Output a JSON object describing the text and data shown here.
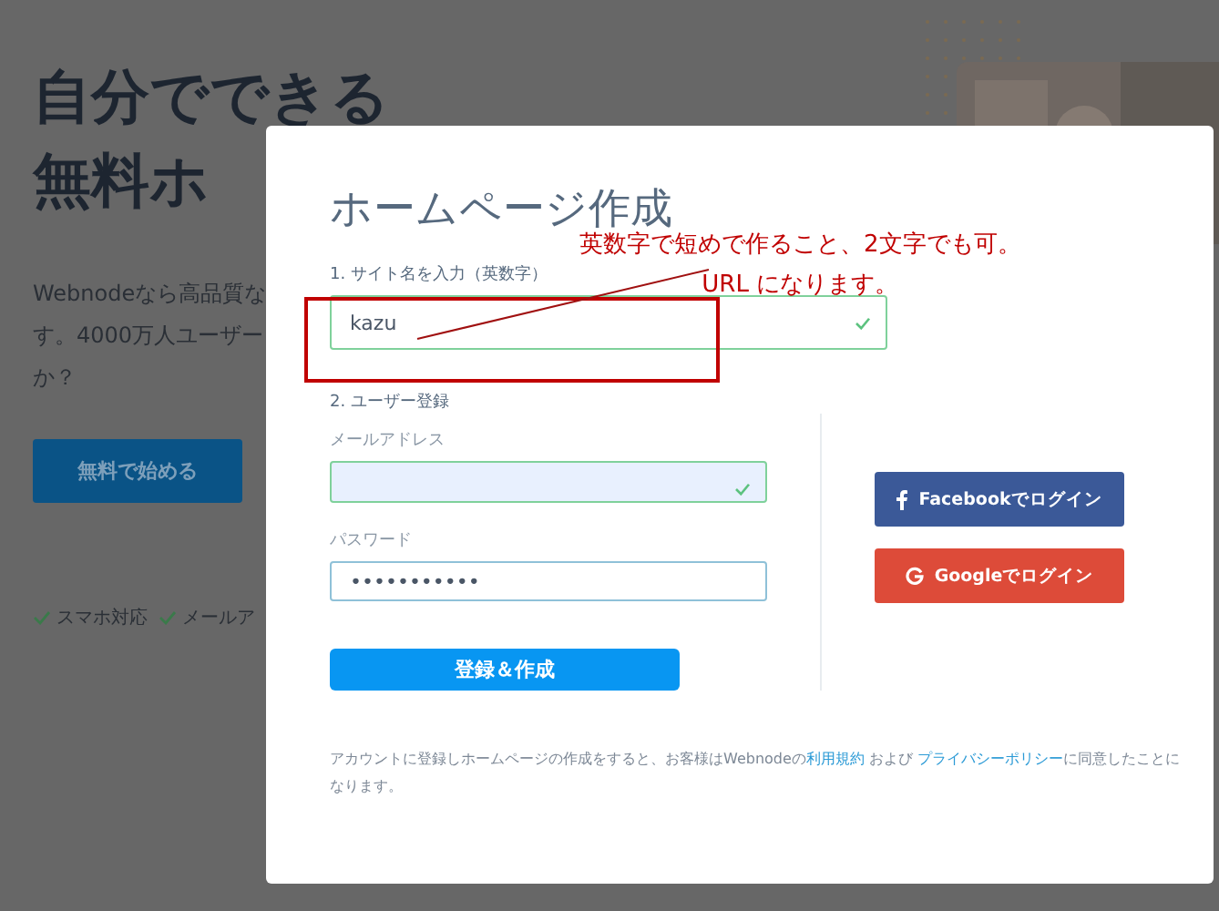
{
  "background_page": {
    "heading_lines": [
      "自分でできる",
      "無料ホ"
    ],
    "description_lines": [
      "Webnodeなら高品質な",
      "す。4000万人ユーザー",
      "か？"
    ],
    "cta_button": "無料で始める",
    "features": [
      "スマホ対応",
      "メールア"
    ]
  },
  "modal": {
    "title": "ホームページ作成",
    "site_name": {
      "label": "1. サイト名を入力（英数字）",
      "value": "kazu",
      "valid": true
    },
    "registration": {
      "label": "2. ユーザー登録",
      "fields": [
        {
          "label": "メールアドレス",
          "valid": true,
          "kind": "email"
        },
        {
          "label": "パスワード",
          "value": "•••••••••••",
          "valid": false,
          "kind": "password"
        }
      ],
      "submit": "登録＆作成",
      "social": [
        {
          "kind": "facebook",
          "label": "Facebookでログイン"
        },
        {
          "kind": "google",
          "label": "Googleでログイン"
        }
      ]
    },
    "terms": {
      "before": "アカウントに登録しホームページの作成をすると、お客様はWebnodeの",
      "link1": "利用規約",
      "middle": " および ",
      "link2": "プライバシーポリシー",
      "after": "に同意したことになります。"
    }
  },
  "annotation": {
    "lines": [
      "英数字で短めで作ること、2文字でも可。",
      "URL になります。"
    ]
  }
}
